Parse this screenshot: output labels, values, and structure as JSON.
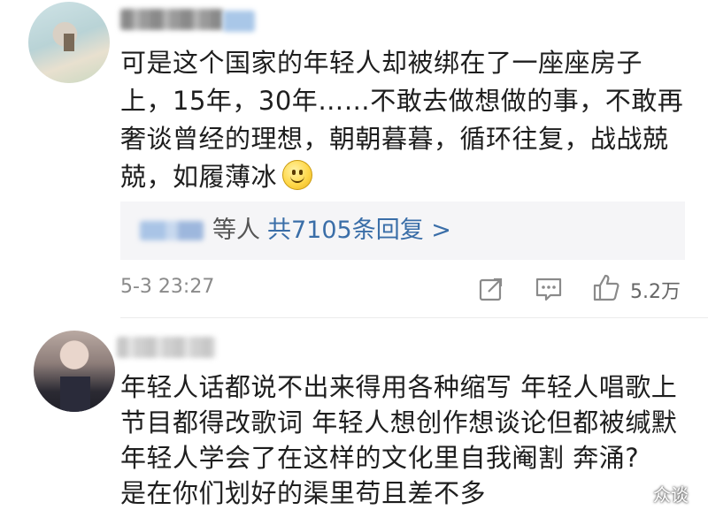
{
  "comments": [
    {
      "avatar": "avatar-blurred",
      "text_lines": [
        "可是这个国家的年轻人却被绑在了一座座房子",
        "上，15年，30年……不敢去做想做的事，不敢再",
        "奢谈曾经的理想，朝朝暮暮，循环往复，战战兢",
        "兢，如履薄冰"
      ],
      "emoji": "smile-emoji",
      "replies": {
        "who_suffix": "等人",
        "link": "共7105条回复 >"
      },
      "timestamp": "5-3 23:27",
      "likes": "5.2万"
    },
    {
      "avatar": "avatar-blurred",
      "text_lines": [
        "年轻人话都说不出来得用各种缩写  年轻人唱歌上",
        "节目都得改歌词 年轻人想创作想谈论但都被缄默",
        "年轻人学会了在这样的文化里自我阉割  奔涌?",
        "是在你们划好的渠里苟且差不多"
      ]
    }
  ],
  "watermark": {
    "text": "众谈",
    "icon": "wechat-icon"
  },
  "colors": {
    "link": "#3a6ea8",
    "meta": "#8a8a8a",
    "reply_bg": "#f5f5f7"
  },
  "icons": [
    "share-icon",
    "comment-icon",
    "like-icon"
  ]
}
